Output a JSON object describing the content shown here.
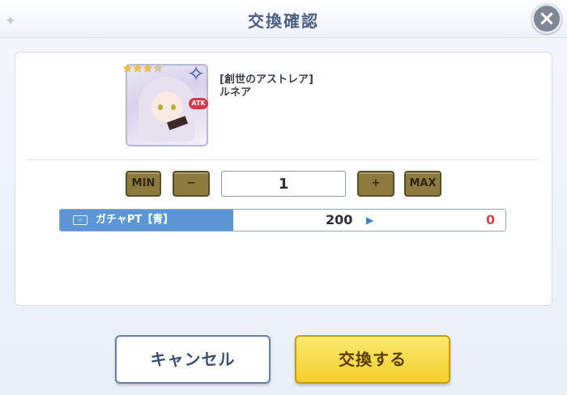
{
  "dialog": {
    "title": "交換確認",
    "close_icon": "close-icon"
  },
  "item": {
    "stars": 3,
    "max_stars": 4,
    "name_line1": "[創世のアストレア]",
    "name_line2": "ルネア",
    "badge": "ATK"
  },
  "quantity": {
    "min_label": "MIN",
    "minus_label": "−",
    "value": "1",
    "plus_label": "+",
    "max_label": "MAX"
  },
  "currency": {
    "label": "ガチャPT【青】",
    "current": "200",
    "after": "0",
    "accent_color": "#5b97d4",
    "after_color": "#d04b4b"
  },
  "footer": {
    "cancel_label": "キャンセル",
    "confirm_label": "交換する"
  }
}
